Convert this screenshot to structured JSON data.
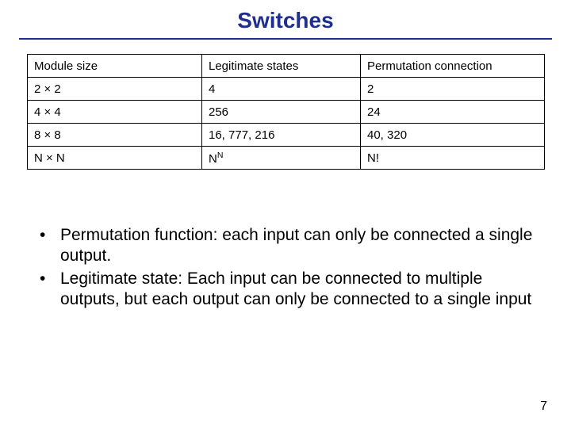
{
  "title": "Switches",
  "table": {
    "headers": [
      "Module size",
      "Legitimate states",
      "Permutation connection"
    ],
    "rows": [
      {
        "c1": "2 × 2",
        "c2": "4",
        "c3": "2"
      },
      {
        "c1": "4 × 4",
        "c2": "256",
        "c3": "24"
      },
      {
        "c1": "8 × 8",
        "c2": "16, 777, 216",
        "c3": "40, 320"
      },
      {
        "c1": "N × N",
        "c2_base": "N",
        "c2_exp": "N",
        "c3": "N!"
      }
    ]
  },
  "bullets": [
    "Permutation function: each input can only be connected a single output.",
    "Legitimate state: Each input can be connected to multiple outputs, but each output can only be connected to a single input"
  ],
  "page_number": "7",
  "chart_data": {
    "type": "table",
    "title": "Switches",
    "columns": [
      "Module size",
      "Legitimate states",
      "Permutation connection"
    ],
    "rows": [
      [
        "2 × 2",
        "4",
        "2"
      ],
      [
        "4 × 4",
        "256",
        "24"
      ],
      [
        "8 × 8",
        "16,777,216",
        "40,320"
      ],
      [
        "N × N",
        "N^N",
        "N!"
      ]
    ]
  }
}
